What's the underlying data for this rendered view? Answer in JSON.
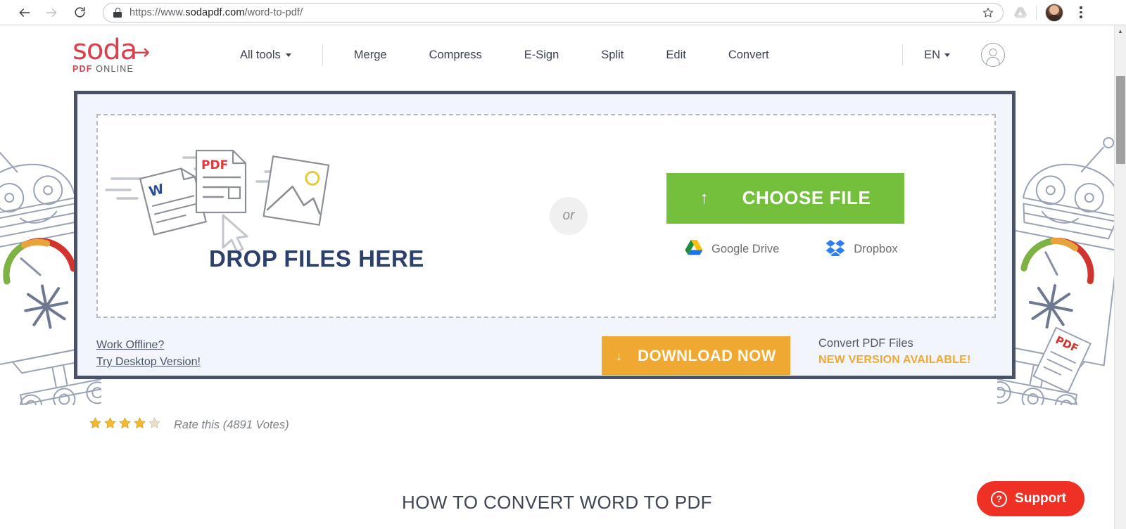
{
  "browser": {
    "back_icon": "back-arrow-icon",
    "forward_icon": "forward-arrow-icon",
    "reload_icon": "reload-icon",
    "lock_icon": "lock-icon",
    "url_scheme": "https://www.",
    "url_domain": "sodapdf.com",
    "url_path": "/word-to-pdf/",
    "bookmark_icon": "star-icon",
    "extension_icon": "drive-extension-icon",
    "avatar_icon": "profile-avatar",
    "menu_icon": "kebab-menu-icon",
    "scroll_up_icon": "scroll-up-arrow-icon"
  },
  "header": {
    "logo": {
      "name": "soda",
      "arrow": "→",
      "pdf": "PDF",
      "online": "ONLINE"
    },
    "nav": [
      {
        "label": "All tools",
        "has_caret": true
      },
      {
        "label": "Merge"
      },
      {
        "label": "Compress"
      },
      {
        "label": "E-Sign"
      },
      {
        "label": "Split"
      },
      {
        "label": "Edit"
      },
      {
        "label": "Convert"
      }
    ],
    "language": "EN",
    "account_icon": "user-account-icon"
  },
  "upload": {
    "drop_title": "DROP FILES HERE",
    "or_label": "or",
    "choose_file": {
      "label": "CHOOSE FILE",
      "icon": "upload-arrow-icon"
    },
    "cloud": [
      {
        "label": "Google Drive",
        "icon": "google-drive-icon"
      },
      {
        "label": "Dropbox",
        "icon": "dropbox-icon"
      }
    ],
    "links": [
      {
        "label": "Work Offline?"
      },
      {
        "label": "Try Desktop Version!"
      }
    ],
    "download": {
      "label": "DOWNLOAD NOW",
      "icon": "download-arrow-icon"
    },
    "convert_note": {
      "line1": "Convert PDF Files",
      "line2": "NEW VERSION AVAILABLE!"
    },
    "illustration": {
      "word_badge": "W",
      "pdf_badge": "PDF",
      "image_icon": "image-file-icon",
      "cursor_icon": "mouse-cursor-icon"
    }
  },
  "rating": {
    "filled_stars": 4,
    "faded_stars": 1,
    "text": "Rate this (4891 Votes)"
  },
  "section": {
    "title": "HOW TO CONVERT WORD TO PDF"
  },
  "support": {
    "label": "Support",
    "icon": "question-circle-icon",
    "glyph": "?"
  },
  "colors": {
    "brand_red": "#d9414f",
    "panel_border": "#4a5268",
    "panel_bg": "#f2f6fc",
    "green": "#74bf3c",
    "orange": "#efa933",
    "support_red": "#ee3124",
    "navy_text": "#2d3f6b"
  }
}
